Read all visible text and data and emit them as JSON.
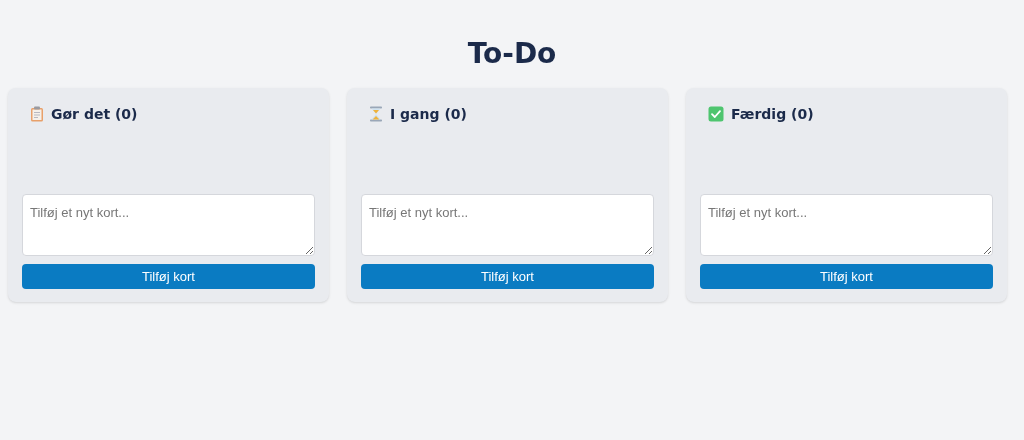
{
  "title": "To-Do",
  "columns": [
    {
      "kind": "clipboard",
      "heading": "Gør det (0)",
      "input": {
        "placeholder": "Tilføj et nyt kort..."
      },
      "button": "Tilføj kort"
    },
    {
      "kind": "hourglass",
      "heading": "I gang (0)",
      "input": {
        "placeholder": "Tilføj et nyt kort..."
      },
      "button": "Tilføj kort"
    },
    {
      "kind": "check",
      "heading": "Færdig (0)",
      "input": {
        "placeholder": "Tilføj et nyt kort..."
      },
      "button": "Tilføj kort"
    }
  ]
}
